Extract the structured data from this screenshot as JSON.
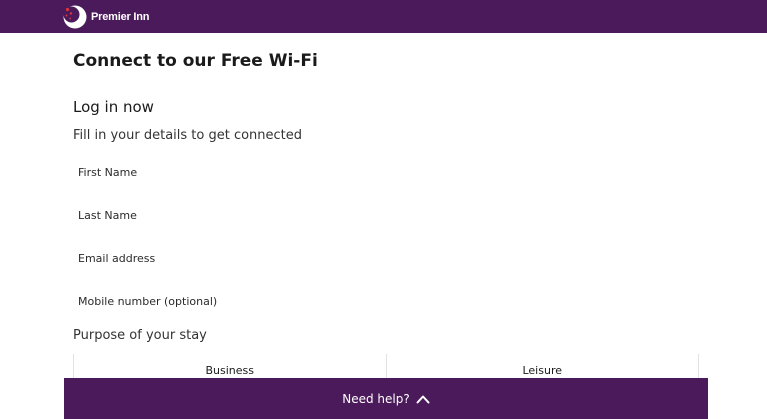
{
  "brand": {
    "name": "Premier Inn",
    "logo_icon": "moon-stars-icon",
    "colors": {
      "header_bg": "#4b1a5b",
      "logo_dots": "#e0333f"
    }
  },
  "main": {
    "title": "Connect to our Free Wi-Fi",
    "section_title": "Log in now",
    "section_subtitle": "Fill in your details to get connected",
    "fields": [
      {
        "label": "First Name",
        "value": ""
      },
      {
        "label": "Last Name",
        "value": ""
      },
      {
        "label": "Email address",
        "value": ""
      },
      {
        "label": "Mobile number (optional)",
        "value": ""
      }
    ],
    "purpose": {
      "label": "Purpose of your stay",
      "options": [
        "Business",
        "Leisure"
      ]
    }
  },
  "footer": {
    "help_label": "Need help?",
    "help_icon": "chevron-up-icon"
  }
}
